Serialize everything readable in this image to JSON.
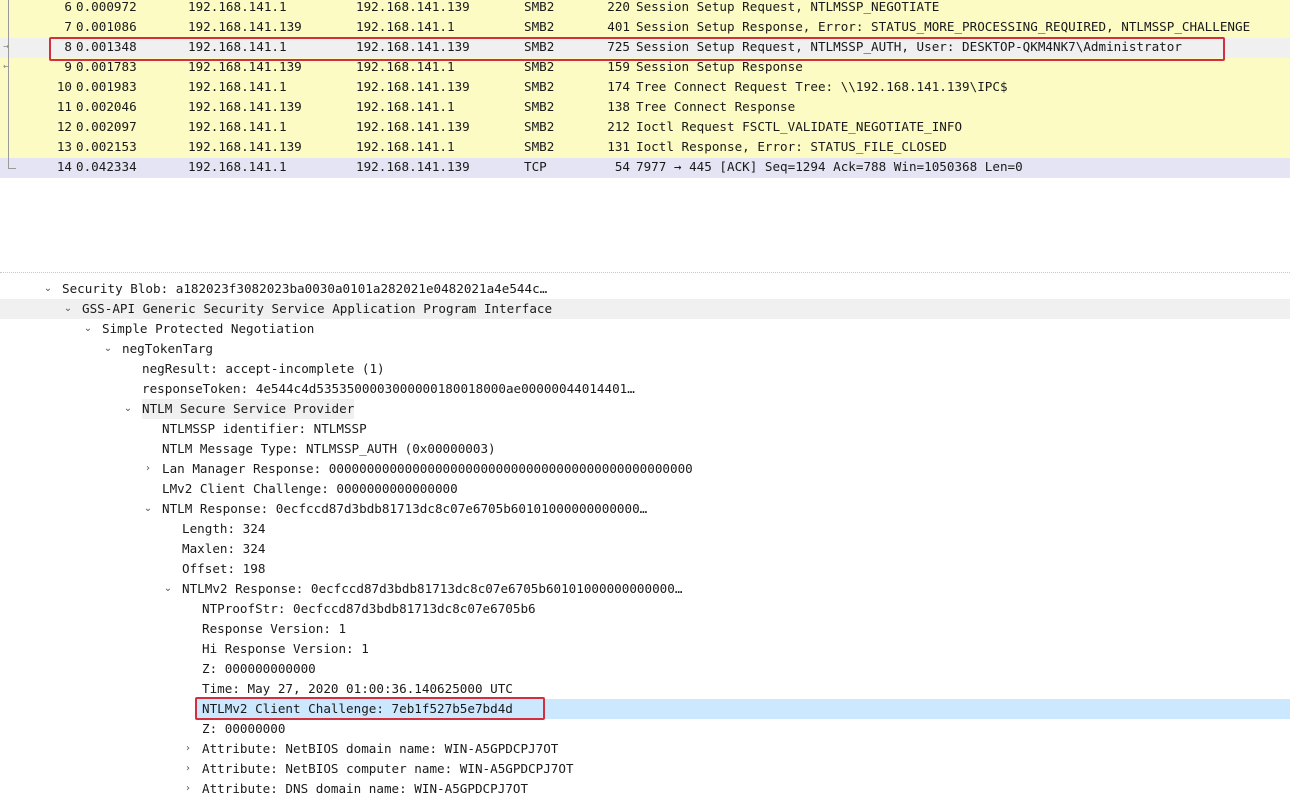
{
  "packet_list": {
    "rows": [
      {
        "no": "6",
        "time": "0.000972",
        "src": "192.168.141.1",
        "dst": "192.168.141.139",
        "proto": "SMB2",
        "len": "220",
        "info": "Session Setup Request, NTLMSSP_NEGOTIATE"
      },
      {
        "no": "7",
        "time": "0.001086",
        "src": "192.168.141.139",
        "dst": "192.168.141.1",
        "proto": "SMB2",
        "len": "401",
        "info": "Session Setup Response, Error: STATUS_MORE_PROCESSING_REQUIRED, NTLMSSP_CHALLENGE"
      },
      {
        "no": "8",
        "time": "0.001348",
        "src": "192.168.141.1",
        "dst": "192.168.141.139",
        "proto": "SMB2",
        "len": "725",
        "info": "Session Setup Request, NTLMSSP_AUTH, User: DESKTOP-QKM4NK7\\Administrator"
      },
      {
        "no": "9",
        "time": "0.001783",
        "src": "192.168.141.139",
        "dst": "192.168.141.1",
        "proto": "SMB2",
        "len": "159",
        "info": "Session Setup Response"
      },
      {
        "no": "10",
        "time": "0.001983",
        "src": "192.168.141.1",
        "dst": "192.168.141.139",
        "proto": "SMB2",
        "len": "174",
        "info": "Tree Connect Request Tree: \\\\192.168.141.139\\IPC$"
      },
      {
        "no": "11",
        "time": "0.002046",
        "src": "192.168.141.139",
        "dst": "192.168.141.1",
        "proto": "SMB2",
        "len": "138",
        "info": "Tree Connect Response"
      },
      {
        "no": "12",
        "time": "0.002097",
        "src": "192.168.141.1",
        "dst": "192.168.141.139",
        "proto": "SMB2",
        "len": "212",
        "info": "Ioctl Request FSCTL_VALIDATE_NEGOTIATE_INFO"
      },
      {
        "no": "13",
        "time": "0.002153",
        "src": "192.168.141.139",
        "dst": "192.168.141.1",
        "proto": "SMB2",
        "len": "131",
        "info": "Ioctl Response, Error: STATUS_FILE_CLOSED"
      },
      {
        "no": "14",
        "time": "0.042334",
        "src": "192.168.141.1",
        "dst": "192.168.141.139",
        "proto": "TCP",
        "len": "54",
        "info": "7977 → 445 [ACK] Seq=1294 Ack=788 Win=1050368 Len=0"
      }
    ]
  },
  "details": {
    "rows": [
      {
        "text": "Security Blob: a182023f3082023ba0030a0101a282021e0482021a4e544c…"
      },
      {
        "text": "GSS-API Generic Security Service Application Program Interface"
      },
      {
        "text": "Simple Protected Negotiation"
      },
      {
        "text": "negTokenTarg"
      },
      {
        "text": "negResult: accept-incomplete (1)"
      },
      {
        "text": "responseToken: 4e544c4d5353500003000000180018000ae00000044014401…"
      },
      {
        "text": "NTLM Secure Service Provider"
      },
      {
        "text": "NTLMSSP identifier: NTLMSSP"
      },
      {
        "text": "NTLM Message Type: NTLMSSP_AUTH (0x00000003)"
      },
      {
        "text": "Lan Manager Response: 000000000000000000000000000000000000000000000000"
      },
      {
        "text": "LMv2 Client Challenge: 0000000000000000"
      },
      {
        "text": "NTLM Response: 0ecfccd87d3bdb81713dc8c07e6705b60101000000000000…"
      },
      {
        "text": "Length: 324"
      },
      {
        "text": "Maxlen: 324"
      },
      {
        "text": "Offset: 198"
      },
      {
        "text": "NTLMv2 Response: 0ecfccd87d3bdb81713dc8c07e6705b60101000000000000…"
      },
      {
        "text": "NTProofStr: 0ecfccd87d3bdb81713dc8c07e6705b6"
      },
      {
        "text": "Response Version: 1"
      },
      {
        "text": "Hi Response Version: 1"
      },
      {
        "text": "Z: 000000000000"
      },
      {
        "text": "Time: May 27, 2020 01:00:36.140625000 UTC"
      },
      {
        "text": "NTLMv2 Client Challenge: 7eb1f527b5e7bd4d"
      },
      {
        "text": "Z: 00000000"
      },
      {
        "text": "Attribute: NetBIOS domain name: WIN-A5GPDCPJ7OT"
      },
      {
        "text": "Attribute: NetBIOS computer name: WIN-A5GPDCPJ7OT"
      },
      {
        "text": "Attribute: DNS domain name: WIN-A5GPDCPJ7OT"
      }
    ]
  },
  "colors": {
    "smb_row": "#fbfbc3",
    "tcp_row": "#e4e4f4",
    "selected_row": "#f0f0f0",
    "highlight_field": "#cce8ff",
    "annotation_box": "#d32f3c"
  }
}
